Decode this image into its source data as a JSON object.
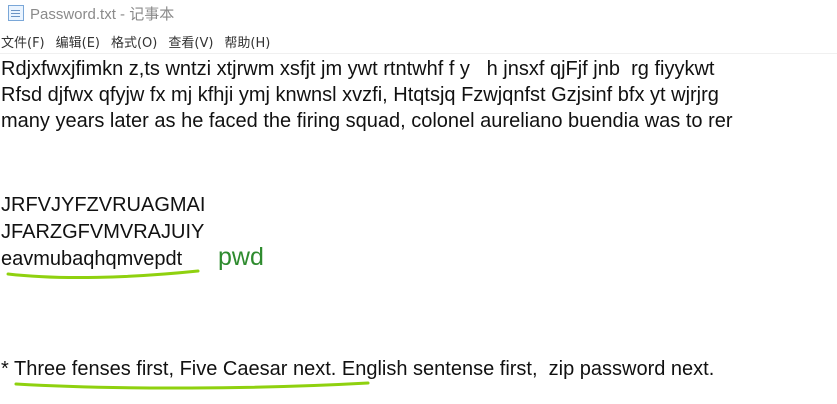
{
  "window": {
    "title": "Password.txt - 记事本",
    "icon": "notepad-icon"
  },
  "menu": [
    "文件(F)",
    "编辑(E)",
    "格式(O)",
    "查看(V)",
    "帮助(H)"
  ],
  "lines": [
    "Rdjxfwxjfimkn z,ts wntzi xtjrwm xsfjt jm ywt rtntwhf f y   h jnsxf qjFjf jnb  rg fiyykwt",
    "Rfsd djfwx qfyjw fx mj kfhji ymj knwnsl xvzfi, Htqtsjq Fzwjqnfst Gzjsinf bfx yt wjrjrg",
    "many years later as he faced the firing squad, colonel aureliano buendia was to rer",
    "",
    "",
    "JRFVJYFZVRUAGMAI",
    "JFARZGFVMVRAJUIY",
    "eavmubaqhqmvepdt",
    "",
    "",
    "",
    "* Three fenses first, Five Caesar next. English sentense first,  zip password next."
  ],
  "annotation": {
    "label": "pwd",
    "color": "#2e8b2e"
  },
  "highlight_color": "#8fd10f"
}
